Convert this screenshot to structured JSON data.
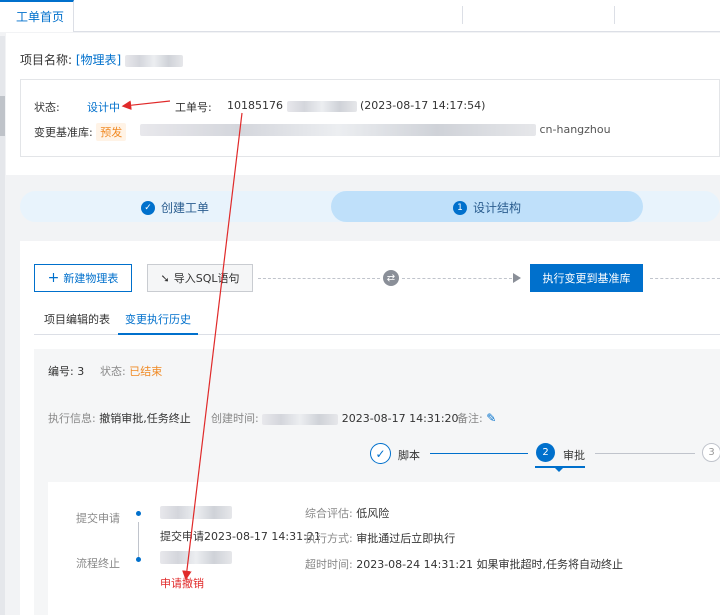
{
  "tabbar": {
    "active_tab": "工单首页"
  },
  "project": {
    "label": "项目名称:",
    "link": "[物理表]"
  },
  "info": {
    "status_label": "状态:",
    "status_value": "设计中",
    "order_label": "工单号:",
    "order_number": "10185176",
    "order_time": "(2023-08-17 14:17:54)",
    "baseline_label": "变更基准库:",
    "baseline_tag": "预发",
    "baseline_region": "cn-hangzhou"
  },
  "steps": [
    {
      "label": "创建工单",
      "icon": "check-icon"
    },
    {
      "label": "设计结构",
      "number": "1"
    }
  ],
  "toolbar": {
    "new_table": "新建物理表",
    "import_sql": "导入SQL语句",
    "execute": "执行变更到基准库"
  },
  "subtabs": [
    "项目编辑的表",
    "变更执行历史"
  ],
  "record": {
    "id_label": "编号:",
    "id_value": "3",
    "status_label": "状态:",
    "status_value": "已结束",
    "exec_info_label": "执行信息:",
    "exec_info_value": "撤销审批,任务终止",
    "created_label": "创建时间:",
    "created_value": "2023-08-17 14:31:20",
    "remark_label": "备注:"
  },
  "timeline": [
    {
      "label": "脚本",
      "number": ""
    },
    {
      "label": "审批",
      "number": "2"
    },
    {
      "label": "",
      "number": "3"
    }
  ],
  "approval": {
    "submit_label": "提交申请",
    "submit_detail": "提交申请2023-08-17 14:31:21",
    "terminate_label": "流程终止",
    "cancel_text": "申请撤销",
    "assess_label": "综合评估:",
    "assess_value": "低风险",
    "exec_mode_label": "执行方式:",
    "exec_mode_value": "审批通过后立即执行",
    "timeout_label": "超时时间:",
    "timeout_value": "2023-08-24 14:31:21",
    "timeout_note": "如果审批超时,任务将自动终止"
  },
  "colors": {
    "primary": "#0070cc",
    "warning": "#f08a24",
    "danger": "#e02a2a"
  }
}
